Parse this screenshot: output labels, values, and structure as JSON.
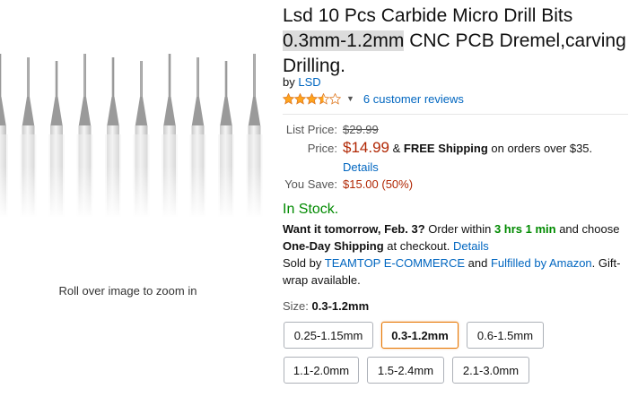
{
  "product": {
    "title_part1": "Lsd 10 Pcs Carbide Micro Drill Bits",
    "title_highlight": "0.3mm-1.2mm",
    "title_part2": " CNC PCB Dremel,carving Drilling.",
    "by_label": "by",
    "brand": "LSD"
  },
  "rating": {
    "stars": 3.5,
    "reviews_text": "6 customer reviews"
  },
  "image": {
    "zoom_hint": "Roll over image to zoom in",
    "drill_count": 10
  },
  "pricing": {
    "list_price_label": "List Price:",
    "list_price": "$29.99",
    "price_label": "Price:",
    "price": "$14.99",
    "shipping_amp": " & ",
    "free_shipping": "FREE Shipping",
    "shipping_suffix": " on orders over $35.",
    "details_link": "Details",
    "you_save_label": "You Save:",
    "you_save": "$15.00 (50%)"
  },
  "availability": {
    "in_stock": "In Stock.",
    "want_it": "Want it tomorrow, Feb. 3?",
    "order_within": " Order within ",
    "countdown": "3 hrs 1 min",
    "and_choose": " and choose",
    "one_day": "One-Day Shipping",
    "at_checkout": " at checkout. ",
    "details_link": "Details",
    "sold_by": "Sold by ",
    "seller": "TEAMTOP E-COMMERCE",
    "and": " and ",
    "fulfilled": "Fulfilled by Amazon",
    "gift_wrap": ". Gift-wrap available."
  },
  "size": {
    "label": "Size:",
    "selected": "0.3-1.2mm",
    "options": [
      "0.25-1.15mm",
      "0.3-1.2mm",
      "0.6-1.5mm",
      "1.1-2.0mm",
      "1.5-2.4mm",
      "2.1-3.0mm"
    ]
  },
  "colors": {
    "link": "#0066c0",
    "price": "#b12704",
    "in_stock": "#008a00",
    "star": "#ffa41c",
    "selected_border": "#e77600"
  }
}
